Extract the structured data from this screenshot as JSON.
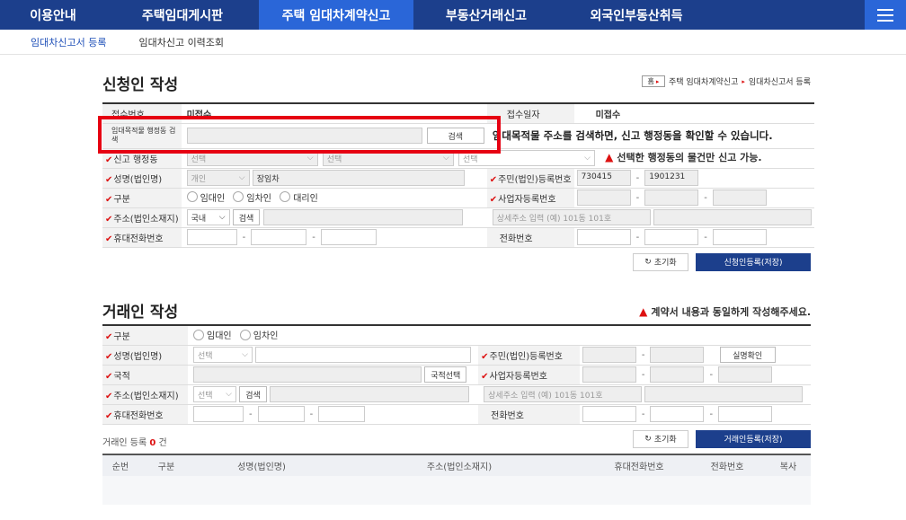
{
  "topnav": {
    "items": [
      "이용안내",
      "주택임대게시판",
      "주택 임대차계약신고",
      "부동산거래신고",
      "외국인부동산취득"
    ],
    "active_index": 2
  },
  "subnav": {
    "items": [
      "임대차신고서 등록",
      "임대차신고 이력조회"
    ]
  },
  "applicant": {
    "title": "신청인 작성",
    "breadcrumb": {
      "home": "홈",
      "path1": "주택 임대차계약신고",
      "path2": "임대차신고서 등록"
    },
    "receipt_no_label": "접수번호",
    "receipt_no_value": "미접수",
    "receipt_date_label": "접수일자",
    "receipt_date_value": "미접수",
    "search_label": "임대목적물 행정동 검색",
    "search_button": "검색",
    "search_hint": "임대목적물 주소를 검색하면, 신고 행정동을 확인할 수 있습니다.",
    "dong_label": "신고 행정동",
    "dong_select1": "선택",
    "dong_select2": "선택",
    "dong_select3": "선택",
    "dong_warning": "선택한 행정동의 물건만 신고 가능.",
    "name_label": "성명(법인명)",
    "name_type": "개인",
    "name_value": "장임차",
    "rrn_label": "주민(법인)등록번호",
    "rrn_front": "730415",
    "rrn_back": "1901231",
    "type_label": "구분",
    "type_options": [
      "임대인",
      "임차인",
      "대리인"
    ],
    "biz_label": "사업자등록번호",
    "addr_label": "주소(법인소재지)",
    "addr_country": "국내",
    "addr_search": "검색",
    "addr_detail_placeholder": "상세주소 입력 (예) 101동 101호",
    "mobile_label": "휴대전화번호",
    "phone_label": "전화번호",
    "reset_button": "초기화",
    "submit_button": "신청인등록(저장)"
  },
  "counterparty": {
    "title": "거래인 작성",
    "warning": "계약서 내용과 동일하게 작성해주세요.",
    "type_label": "구분",
    "type_options": [
      "임대인",
      "임차인"
    ],
    "name_label": "성명(법인명)",
    "name_type": "선택",
    "rrn_label": "주민(법인)등록번호",
    "verify_button": "실명확인",
    "nation_label": "국적",
    "nation_button": "국적선택",
    "biz_label": "사업자등록번호",
    "addr_label": "주소(법인소재지)",
    "addr_country": "선택",
    "addr_search": "검색",
    "addr_detail_placeholder": "상세주소 입력 (예) 101동 101호",
    "mobile_label": "휴대전화번호",
    "phone_label": "전화번호",
    "reset_button": "초기화",
    "submit_button": "거래인등록(저장)",
    "count_prefix": "거래인 등록",
    "count_value": "0",
    "count_suffix": "건",
    "table_headers": [
      "순번",
      "구분",
      "성명(법인명)",
      "주소(법인소재지)",
      "휴대전화번호",
      "전화번호",
      "복사"
    ]
  },
  "colors": {
    "nav_bg": "#1c3f8c",
    "nav_active": "#2a66d8",
    "required": "#d11111",
    "highlight": "#e60012"
  }
}
